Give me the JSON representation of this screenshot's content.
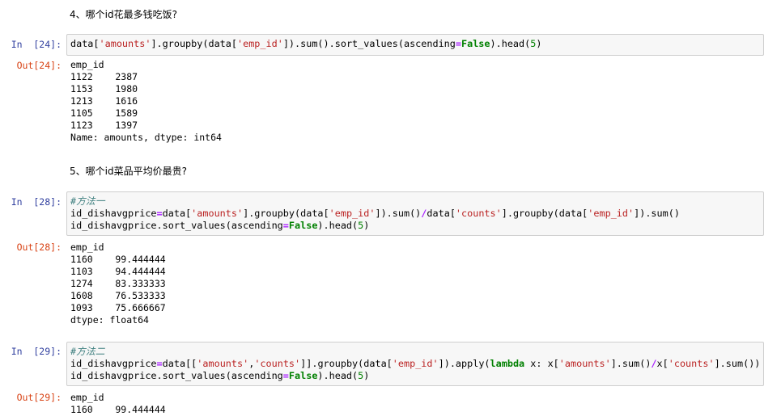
{
  "markdown": {
    "heading4": "4、哪个id花最多钱吃饭?",
    "heading5": "5、哪个id菜品平均价最贵?"
  },
  "cells": [
    {
      "in_prompt": "In  [24]:",
      "out_prompt": "Out[24]:",
      "code": "data['amounts'].groupby(data['emp_id']).sum().sort_values(ascending=False).head(5)",
      "output": [
        "emp_id",
        "1122    2387",
        "1153    1980",
        "1213    1616",
        "1105    1589",
        "1123    1397",
        "Name: amounts, dtype: int64"
      ]
    },
    {
      "in_prompt": "In  [28]:",
      "out_prompt": "Out[28]:",
      "comment": "#方法一",
      "code_line2": "id_dishavgprice=data['amounts'].groupby(data['emp_id']).sum()/data['counts'].groupby(data['emp_id']).sum()",
      "code_line3": "id_dishavgprice.sort_values(ascending=False).head(5)",
      "output": [
        "emp_id",
        "1160    99.444444",
        "1103    94.444444",
        "1274    83.333333",
        "1608    76.533333",
        "1093    75.666667",
        "dtype: float64"
      ]
    },
    {
      "in_prompt": "In  [29]:",
      "out_prompt": "Out[29]:",
      "comment": "#方法二",
      "code_line2": "id_dishavgprice=data[['amounts','counts']].groupby(data['emp_id']).apply(lambda x: x['amounts'].sum()/x['counts'].sum())",
      "code_line3": "id_dishavgprice.sort_values(ascending=False).head(5)",
      "output": [
        "emp_id",
        "1160    99.444444"
      ]
    }
  ],
  "colors": {
    "in_prompt": "#303f9f",
    "out_prompt": "#d84315",
    "string": "#ba2121",
    "keyword": "#008000",
    "operator": "#aa22ff",
    "comment": "#408080",
    "cell_bg": "#f7f7f7",
    "cell_border": "#cfcfcf"
  }
}
